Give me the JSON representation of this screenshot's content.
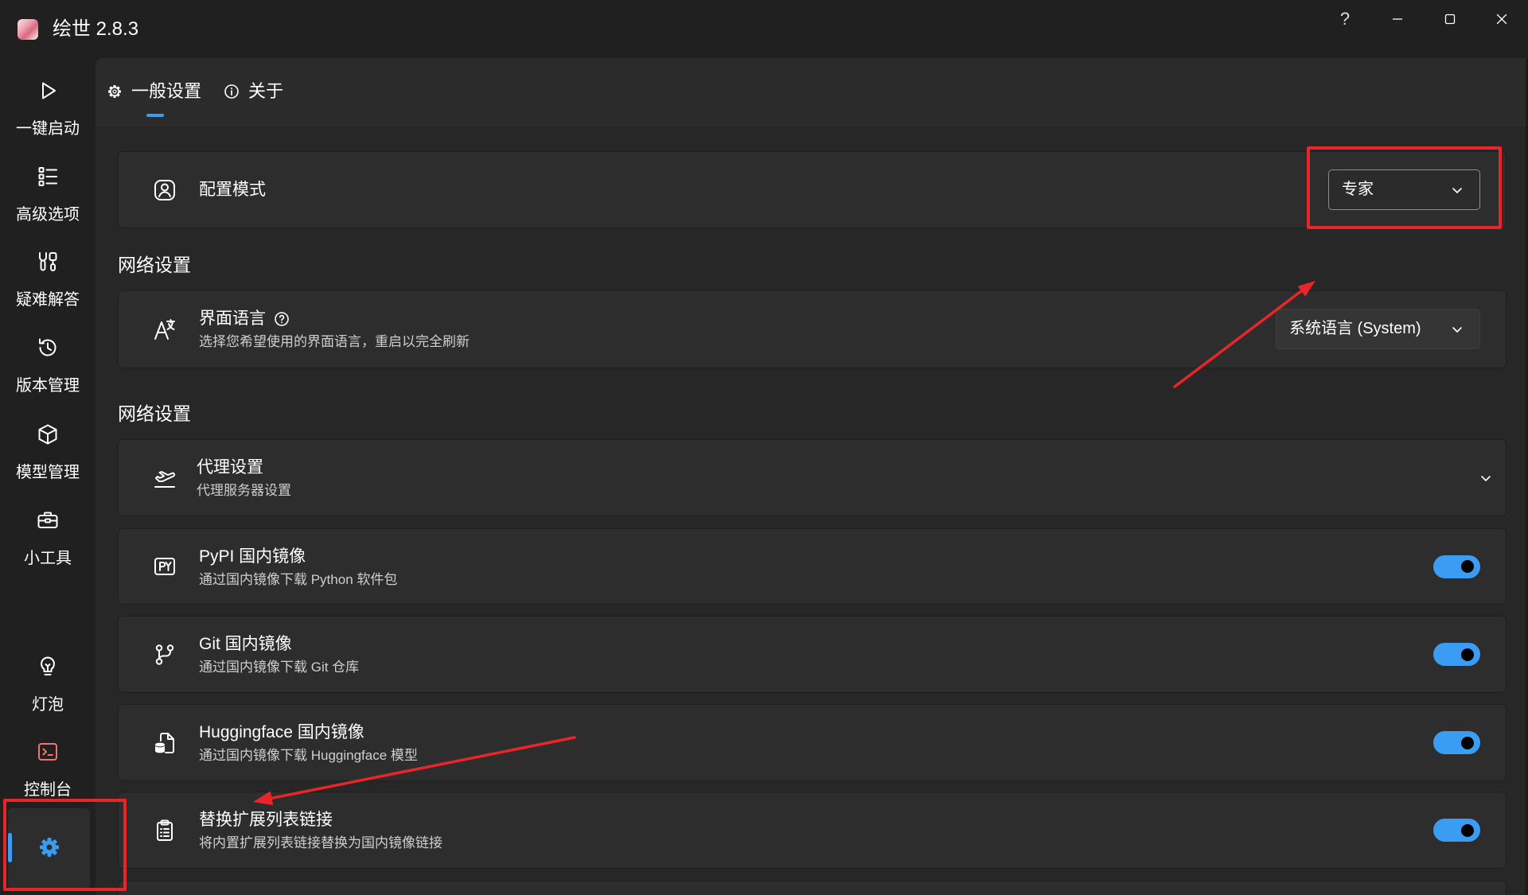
{
  "window": {
    "title": "绘世 2.8.3",
    "app_icon": "app-logo-icon",
    "help_label": "?",
    "control_icons": [
      "minimize-icon",
      "maximize-icon",
      "close-icon"
    ]
  },
  "sidebar": {
    "items": [
      {
        "label": "一键启动",
        "icon": "play-icon"
      },
      {
        "label": "高级选项",
        "icon": "list-icon"
      },
      {
        "label": "疑难解答",
        "icon": "tools-icon"
      },
      {
        "label": "版本管理",
        "icon": "history-icon"
      },
      {
        "label": "模型管理",
        "icon": "cube-icon"
      },
      {
        "label": "小工具",
        "icon": "toolbox-icon"
      },
      {
        "label": "灯泡",
        "icon": "lightbulb-icon"
      },
      {
        "label": "控制台",
        "icon": "console-icon"
      }
    ],
    "settings_button": {
      "icon": "gear-icon",
      "selected": true
    }
  },
  "tabs": [
    {
      "label": "一般设置",
      "icon": "gear-icon",
      "active": true
    },
    {
      "label": "关于",
      "icon": "info-icon",
      "active": false
    }
  ],
  "settings": {
    "config_mode": {
      "title": "配置模式",
      "icon": "config-mode-icon",
      "value": "专家"
    },
    "section_a": {
      "header": "网络设置",
      "language": {
        "title": "界面语言",
        "help_icon": "help-circle-icon",
        "subtitle": "选择您希望使用的界面语言，重启以完全刷新",
        "value": "系统语言 (System)",
        "icon": "language-icon"
      }
    },
    "section_b": {
      "header": "网络设置",
      "proxy": {
        "title": "代理设置",
        "subtitle": "代理服务器设置",
        "icon": "proxy-plane-icon",
        "expanded": false
      },
      "toggles": [
        {
          "title": "PyPI 国内镜像",
          "subtitle": "通过国内镜像下载 Python 软件包",
          "icon": "pypi-icon",
          "on": true
        },
        {
          "title": "Git 国内镜像",
          "subtitle": "通过国内镜像下载 Git 仓库",
          "icon": "git-branch-icon",
          "on": true
        },
        {
          "title": "Huggingface 国内镜像",
          "subtitle": "通过国内镜像下载 Huggingface 模型",
          "icon": "file-database-icon",
          "on": true
        },
        {
          "title": "替换扩展列表链接",
          "subtitle": "将内置扩展列表链接替换为国内镜像链接",
          "icon": "clipboard-list-icon",
          "on": true
        }
      ]
    }
  },
  "colors": {
    "accent": "#3a9cf2",
    "annotation": "#e8262a",
    "console_icon": "#f07272",
    "background": "#202020",
    "panel": "#272727",
    "header": "#2b2b2b",
    "card": "#2d2d2d"
  }
}
